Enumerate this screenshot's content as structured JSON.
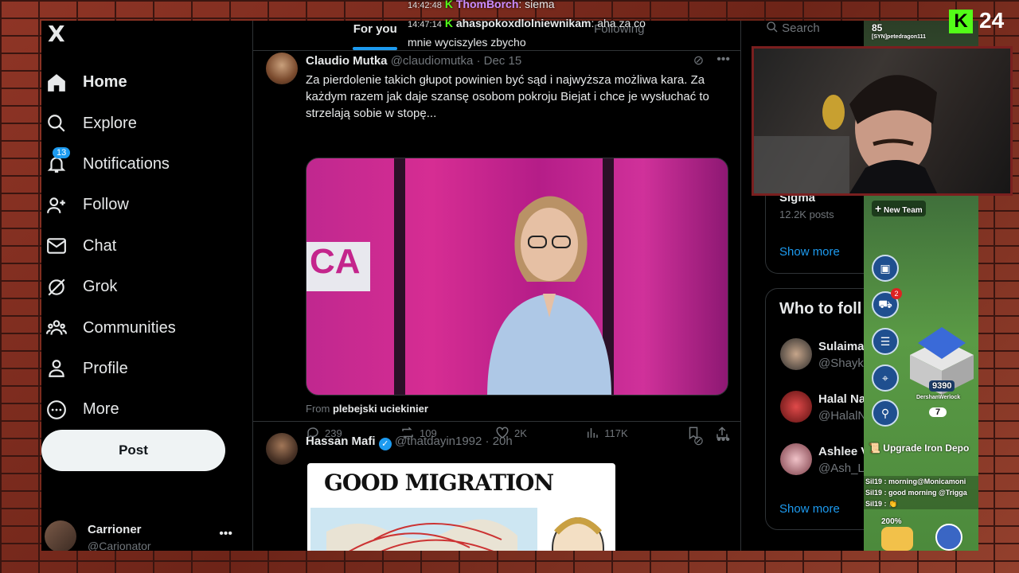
{
  "sidebar": {
    "logo": "X",
    "items": [
      {
        "label": "Home",
        "icon": "home-icon"
      },
      {
        "label": "Explore",
        "icon": "search-icon"
      },
      {
        "label": "Notifications",
        "icon": "bell-icon",
        "badge": "13"
      },
      {
        "label": "Follow",
        "icon": "person-add-icon"
      },
      {
        "label": "Chat",
        "icon": "mail-icon"
      },
      {
        "label": "Grok",
        "icon": "grok-icon"
      },
      {
        "label": "Communities",
        "icon": "people-icon"
      },
      {
        "label": "Profile",
        "icon": "person-icon"
      },
      {
        "label": "More",
        "icon": "more-circle-icon"
      }
    ],
    "post_label": "Post",
    "account": {
      "name": "Carrioner",
      "handle": "@Carionator"
    }
  },
  "feed": {
    "tabs": [
      "For you",
      "Following"
    ],
    "tweets": [
      {
        "name": "Claudio Mutka",
        "handle": "@claudiomutka",
        "date": "· Dec 15",
        "text": "Za pierdolenie takich głupot powinien być sąd i najwyższa możliwa kara. Za każdym razem jak daje szansę osobom pokroju Biejat i chce je wysłuchać to strzelają sobie w stopę...",
        "media_label": "CA",
        "from_prefix": "From",
        "from_account": "plebejski uciekinier",
        "replies": "239",
        "reposts": "109",
        "likes": "2K",
        "views": "117K"
      },
      {
        "name": "Hassan Mafi",
        "handle": "@thatdayin1992",
        "date": "· 20h",
        "meme_title": "GOOD MIGRATION"
      }
    ]
  },
  "right": {
    "search_placeholder": "Search",
    "trend_name": "Sigma",
    "trend_posts": "12.2K posts",
    "show_more": "Show more",
    "who_to_follow_title": "Who to foll",
    "follow": [
      {
        "name": "Sulaima",
        "handle": "@Shayk"
      },
      {
        "name": "Halal Na",
        "handle": "@HalalN"
      },
      {
        "name": "Ashlee V",
        "handle": "@Ash_Le"
      }
    ],
    "show_more_2": "Show more"
  },
  "stream_chat": [
    {
      "time": "14:42:48",
      "user": "ThomBorch",
      "text": ": siema"
    },
    {
      "time": "14:47:14",
      "user": "ahaspokoxdlolniewnikam",
      "text": ": aha za co mnie wyciszyles zbycho"
    }
  ],
  "game": {
    "level": "85",
    "player_tag": "[SYN]petedragon111",
    "new_team": "New Team",
    "notif_count": "2",
    "score": "9390",
    "player_name": "DershanWerlock",
    "count": "7",
    "upgrade": "Upgrade Iron Depo",
    "chat": [
      "Sil19 : morning@Monicamoni",
      "Sil19 : good morning @Trigga",
      "Sil19 : 👏"
    ],
    "bonus": "200%"
  },
  "kick": {
    "logo": "K",
    "number": "24"
  },
  "colors": {
    "accent": "#1d9bf0",
    "kick": "#53fc18",
    "background": "#000000"
  }
}
